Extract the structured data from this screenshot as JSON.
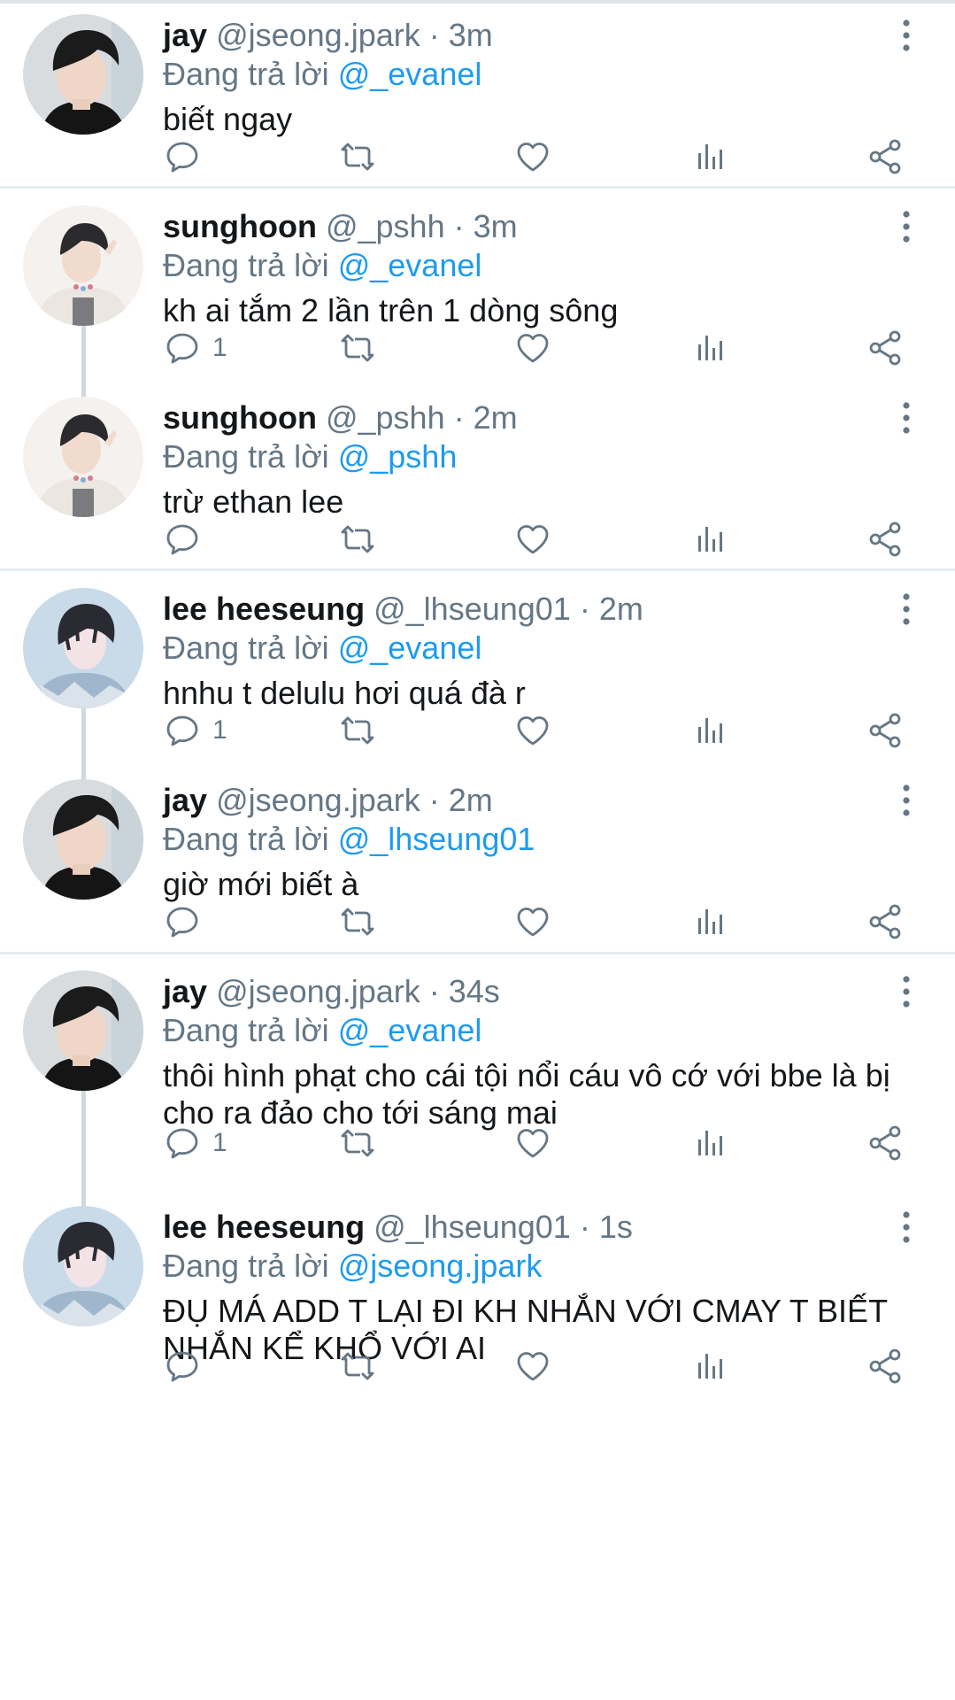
{
  "reply_prefix": "Đang trả lời",
  "dot": "·",
  "tweets": [
    {
      "name": "jay",
      "handle": "@jseong.jpark",
      "time": "3m",
      "reply_to": "@_evanel",
      "text": "biết ngay",
      "replies": "",
      "avatar": "avatar-jay"
    },
    {
      "name": "sunghoon",
      "handle": "@_pshh",
      "time": "3m",
      "reply_to": "@_evanel",
      "text": "kh ai tắm 2 lần trên 1 dòng sông",
      "replies": "1",
      "avatar": "avatar-sunghoon"
    },
    {
      "name": "sunghoon",
      "handle": "@_pshh",
      "time": "2m",
      "reply_to": "@_pshh",
      "text": "trừ ethan lee",
      "replies": "",
      "avatar": "avatar-sunghoon"
    },
    {
      "name": "lee heeseung",
      "handle": "@_lhseung01",
      "time": "2m",
      "reply_to": "@_evanel",
      "text": "hnhu t delulu hơi quá đà r",
      "replies": "1",
      "avatar": "avatar-heeseung"
    },
    {
      "name": "jay",
      "handle": "@jseong.jpark",
      "time": "2m",
      "reply_to": "@_lhseung01",
      "text": "giờ mới biết à",
      "replies": "",
      "avatar": "avatar-jay"
    },
    {
      "name": "jay",
      "handle": "@jseong.jpark",
      "time": "34s",
      "reply_to": "@_evanel",
      "text": "thôi hình phạt cho cái tội nổi cáu vô cớ với bbe là bị cho ra đảo cho tới sáng mai",
      "replies": "1",
      "avatar": "avatar-jay"
    },
    {
      "name": "lee heeseung",
      "handle": "@_lhseung01",
      "time": "1s",
      "reply_to": "@jseong.jpark",
      "text": "ĐỤ MÁ ADD T LẠI ĐI KH NHẮN VỚI CMAY T BIẾT NHẮN KỂ KHỔ VỚI AI",
      "replies": "",
      "avatar": "avatar-heeseung"
    }
  ],
  "colors": {
    "name": "#14171a",
    "muted": "#657786",
    "mention": "#1d9bf0",
    "divider": "#e6ecf0",
    "thread_line": "#cfd9de"
  },
  "icons": [
    "reply-icon",
    "retweet-icon",
    "like-icon",
    "analytics-icon",
    "share-icon",
    "more-icon"
  ]
}
